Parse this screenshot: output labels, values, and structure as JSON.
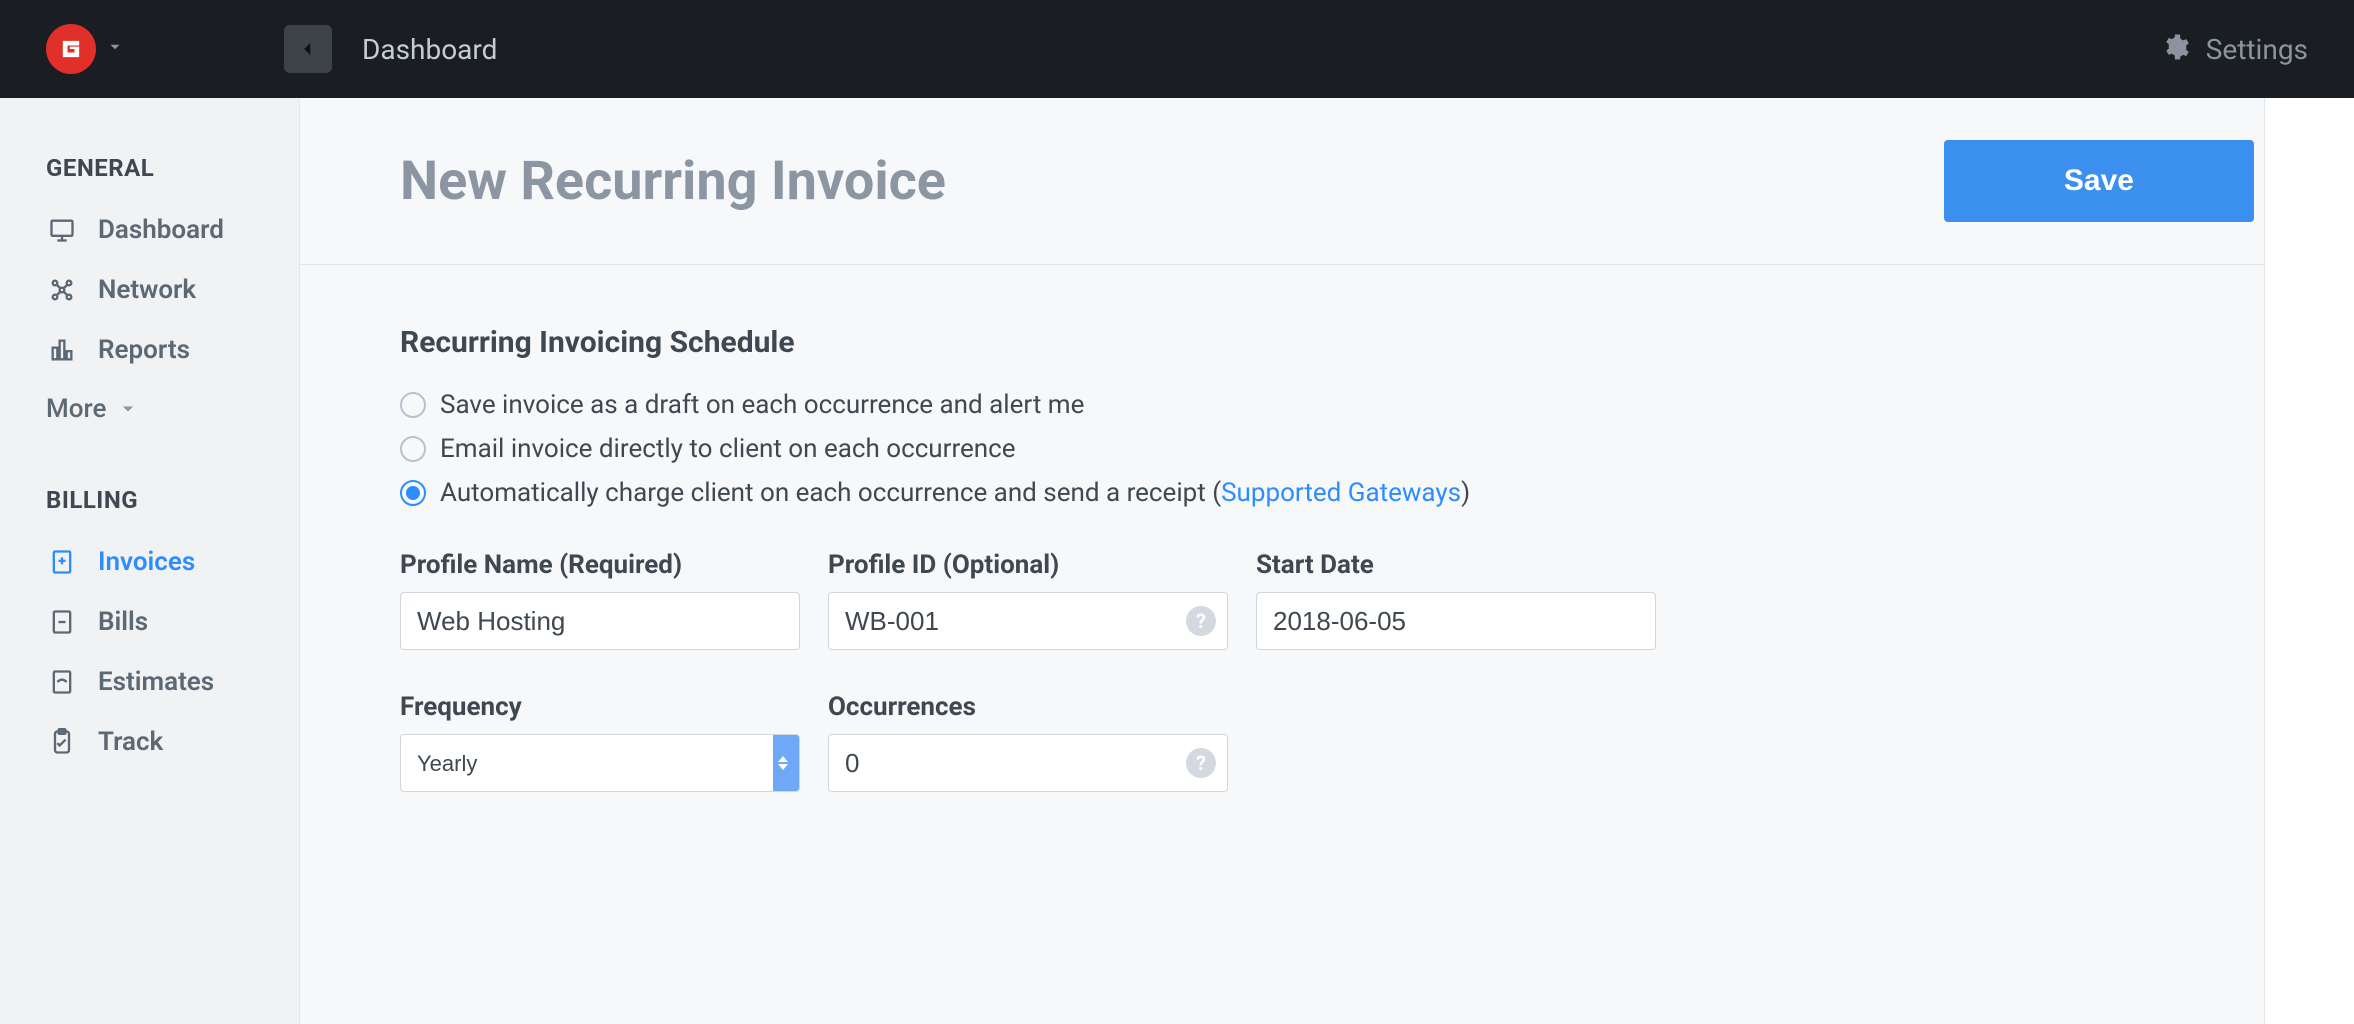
{
  "topbar": {
    "breadcrumb": "Dashboard",
    "settings_label": "Settings"
  },
  "sidebar": {
    "section_general": "GENERAL",
    "general_items": [
      {
        "label": "Dashboard",
        "icon": "dashboard-icon",
        "active": false
      },
      {
        "label": "Network",
        "icon": "network-icon",
        "active": false
      },
      {
        "label": "Reports",
        "icon": "reports-icon",
        "active": false
      }
    ],
    "more_label": "More",
    "section_billing": "BILLING",
    "billing_items": [
      {
        "label": "Invoices",
        "icon": "invoices-icon",
        "active": true
      },
      {
        "label": "Bills",
        "icon": "bills-icon",
        "active": false
      },
      {
        "label": "Estimates",
        "icon": "estimates-icon",
        "active": false
      },
      {
        "label": "Track",
        "icon": "track-icon",
        "active": false
      }
    ]
  },
  "page": {
    "title": "New Recurring Invoice",
    "save_label": "Save"
  },
  "schedule": {
    "section_title": "Recurring Invoicing Schedule",
    "options": {
      "draft": "Save invoice as a draft on each occurrence and alert me",
      "email": "Email invoice directly to client on each occurrence",
      "charge_prefix": "Automatically charge client on each occurrence and send a receipt (",
      "charge_link": "Supported Gateways",
      "charge_suffix": ")"
    },
    "selected": "charge",
    "fields": {
      "profile_name": {
        "label": "Profile Name (Required)",
        "value": "Web Hosting"
      },
      "profile_id": {
        "label": "Profile ID (Optional)",
        "value": "WB-001"
      },
      "start_date": {
        "label": "Start Date",
        "value": "2018-06-05"
      },
      "frequency": {
        "label": "Frequency",
        "value": "Yearly"
      },
      "occurrences": {
        "label": "Occurrences",
        "value": "0"
      }
    }
  },
  "colors": {
    "accent": "#2d8cff",
    "brand_red": "#e1302a",
    "topbar": "#1a1e22"
  }
}
